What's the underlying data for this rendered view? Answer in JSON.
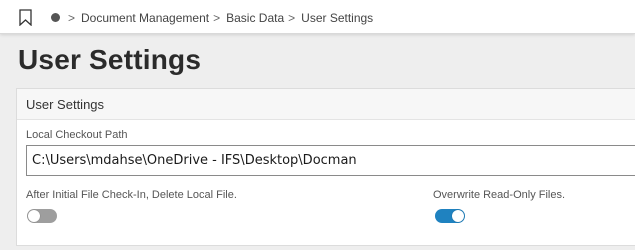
{
  "breadcrumb": {
    "items": [
      "Document Management",
      "Basic Data",
      "User Settings"
    ]
  },
  "page": {
    "title": "User Settings"
  },
  "card": {
    "header": "User Settings",
    "checkout_path": {
      "label": "Local Checkout Path",
      "value": "C:\\Users\\mdahse\\OneDrive - IFS\\Desktop\\Docman"
    },
    "delete_local": {
      "label": "After Initial File Check-In, Delete Local File.",
      "checked": false
    },
    "overwrite_readonly": {
      "label": "Overwrite Read-Only Files.",
      "checked": true
    }
  },
  "colors": {
    "accent": "#1f82c0",
    "toggle_off": "#9e9e9e"
  },
  "icons": {
    "bookmark": "bookmark-icon",
    "home": "home-dot-icon",
    "separator": "chevron-right-icon"
  }
}
